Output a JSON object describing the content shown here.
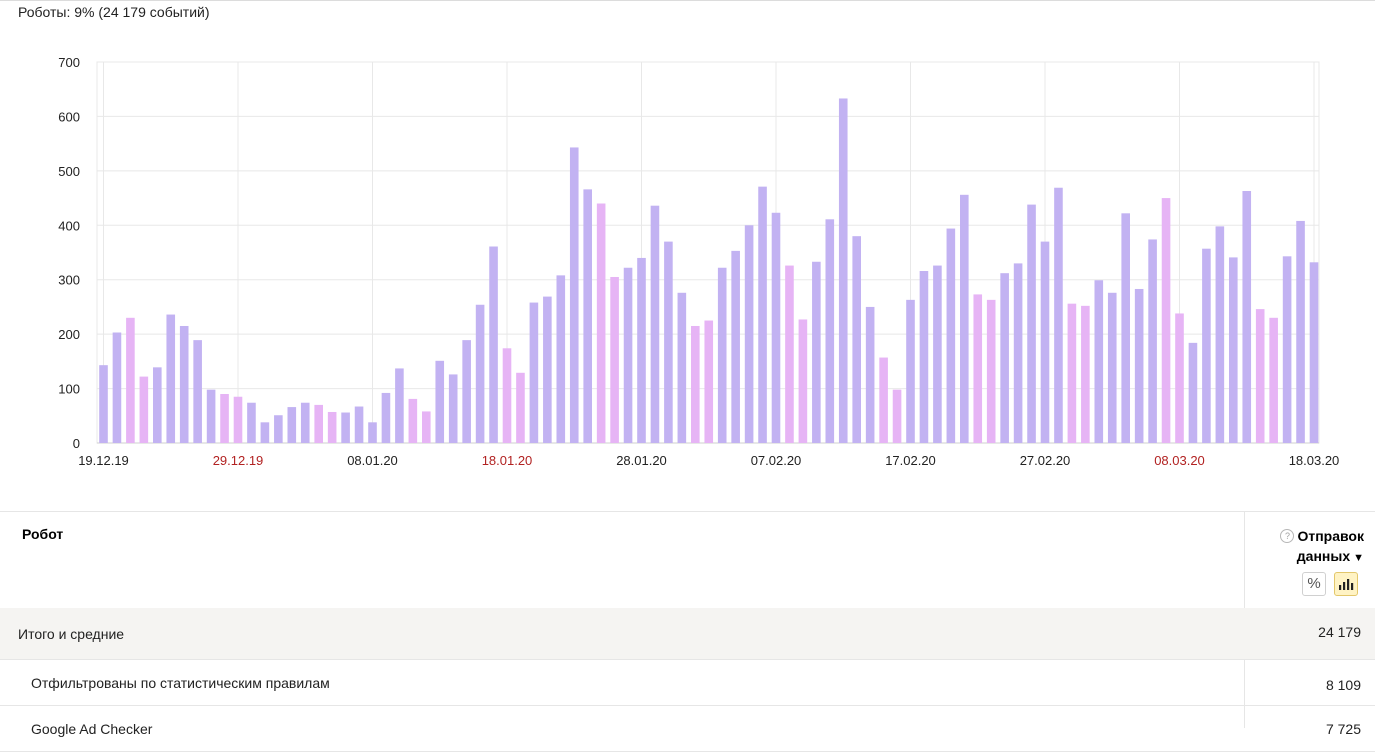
{
  "summary": "Роботы: 9% (24 179 событий)",
  "table": {
    "col_robot": "Робот",
    "col_metric": "Отправок данных",
    "help_icon": "?",
    "sort_icon": "▼",
    "pct_toggle_label": "%",
    "rows": [
      {
        "name": "Итого и средние",
        "value": "24 179"
      },
      {
        "name": "Отфильтрованы по статистическим правилам",
        "value": "8 109"
      },
      {
        "name": "Google Ad Checker",
        "value": "7 725"
      }
    ]
  },
  "colors": {
    "weekday_bar": "#c2b2f2",
    "holiday_bar": "#e6b4f5",
    "holiday_label": "#b22222",
    "grid": "#e8e8e8"
  },
  "chart_data": {
    "type": "bar",
    "start_date": "19.12.19",
    "x_tick_labels": [
      {
        "label": "19.12.19",
        "index": 0,
        "holiday": false
      },
      {
        "label": "29.12.19",
        "index": 10,
        "holiday": true
      },
      {
        "label": "08.01.20",
        "index": 20,
        "holiday": false
      },
      {
        "label": "18.01.20",
        "index": 30,
        "holiday": true
      },
      {
        "label": "28.01.20",
        "index": 40,
        "holiday": false
      },
      {
        "label": "07.02.20",
        "index": 50,
        "holiday": false
      },
      {
        "label": "17.02.20",
        "index": 60,
        "holiday": false
      },
      {
        "label": "27.02.20",
        "index": 70,
        "holiday": false
      },
      {
        "label": "08.03.20",
        "index": 80,
        "holiday": true
      },
      {
        "label": "18.03.20",
        "index": 90,
        "holiday": false
      }
    ],
    "ylim": [
      0,
      700
    ],
    "y_ticks": [
      0,
      100,
      200,
      300,
      400,
      500,
      600,
      700
    ],
    "grid": true,
    "values": [
      143,
      203,
      230,
      122,
      139,
      236,
      215,
      189,
      98,
      90,
      85,
      74,
      38,
      51,
      66,
      74,
      70,
      57,
      56,
      67,
      38,
      92,
      137,
      81,
      58,
      151,
      126,
      189,
      254,
      361,
      174,
      129,
      258,
      269,
      308,
      543,
      466,
      440,
      305,
      322,
      340,
      436,
      370,
      276,
      215,
      225,
      322,
      353,
      400,
      471,
      423,
      326,
      227,
      333,
      411,
      633,
      380,
      250,
      157,
      98,
      263,
      316,
      326,
      394,
      456,
      273,
      263,
      312,
      330,
      438,
      370,
      469,
      256,
      252,
      299,
      276,
      422,
      283,
      374,
      450,
      238,
      184,
      357,
      398,
      341,
      463,
      246,
      230,
      343,
      408,
      332
    ],
    "holiday": [
      false,
      false,
      true,
      true,
      false,
      false,
      false,
      false,
      false,
      true,
      true,
      false,
      false,
      false,
      false,
      false,
      true,
      true,
      false,
      false,
      false,
      false,
      false,
      true,
      true,
      false,
      false,
      false,
      false,
      false,
      true,
      true,
      false,
      false,
      false,
      false,
      false,
      true,
      true,
      false,
      false,
      false,
      false,
      false,
      true,
      true,
      false,
      false,
      false,
      false,
      false,
      true,
      true,
      false,
      false,
      false,
      false,
      false,
      true,
      true,
      false,
      false,
      false,
      false,
      false,
      true,
      true,
      false,
      false,
      false,
      false,
      false,
      true,
      true,
      false,
      false,
      false,
      false,
      false,
      true,
      true,
      false,
      false,
      false,
      false,
      false,
      true,
      true,
      false,
      false,
      false
    ]
  }
}
